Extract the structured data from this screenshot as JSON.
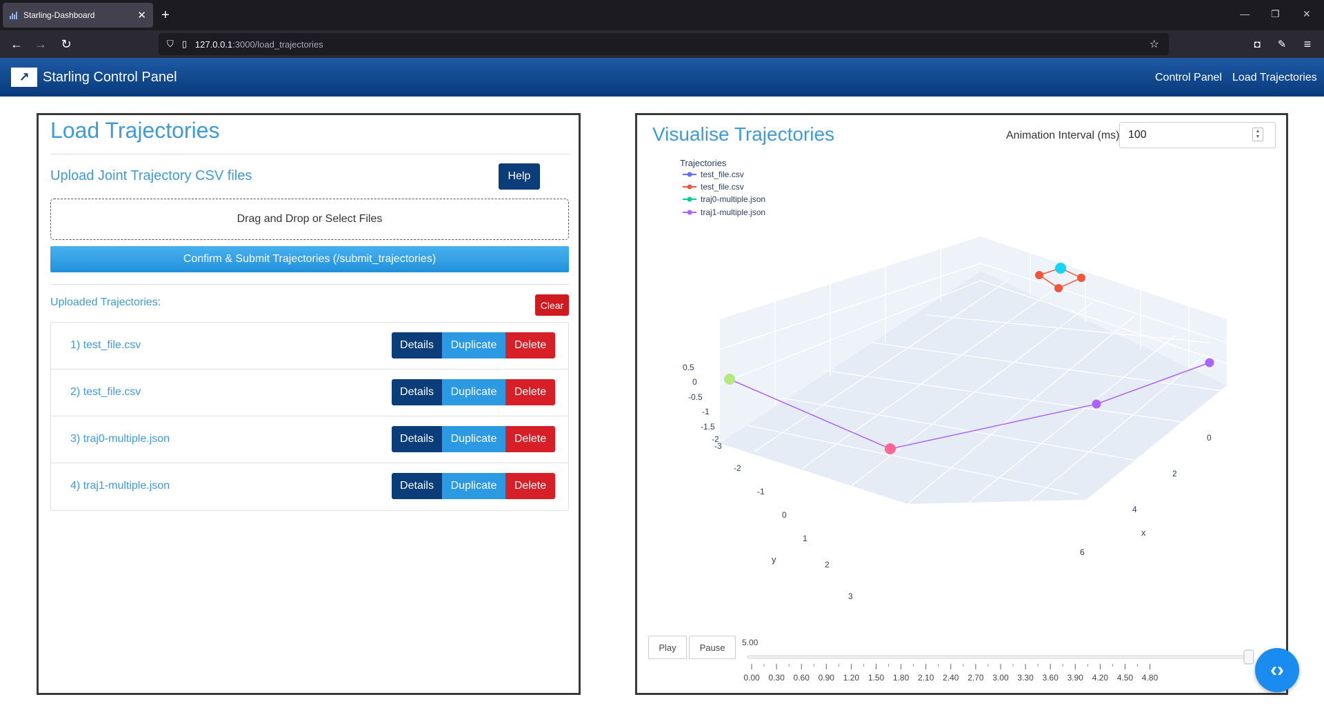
{
  "browser": {
    "tab_title": "Starling-Dashboard",
    "url_host": "127.0.0.1",
    "url_path": ":3000/load_trajectories"
  },
  "app": {
    "title": "Starling Control Panel",
    "nav": [
      "Control Panel",
      "Load Trajectories"
    ]
  },
  "load": {
    "heading": "Load Trajectories",
    "upload_heading": "Upload Joint Trajectory CSV files",
    "help_label": "Help",
    "dropzone_text": "Drag and Drop or Select Files",
    "confirm_label": "Confirm & Submit Trajectories (/submit_trajectories)",
    "uploaded_label": "Uploaded Trajectories:",
    "clear_label": "Clear",
    "details_label": "Details",
    "duplicate_label": "Duplicate",
    "delete_label": "Delete",
    "trajectories": [
      "1) test_file.csv",
      "2) test_file.csv",
      "3) traj0-multiple.json",
      "4) traj1-multiple.json"
    ]
  },
  "vis": {
    "heading": "Visualise Trajectories",
    "interval_label": "Animation Interval (ms)",
    "interval_value": "100",
    "play_label": "Play",
    "pause_label": "Pause",
    "slider_value": "5.00",
    "slider_fraction": 1.0,
    "slider_ticks": [
      "0.00",
      "0.30",
      "0.60",
      "0.90",
      "1.20",
      "1.50",
      "1.80",
      "2.10",
      "2.40",
      "2.70",
      "3.00",
      "3.30",
      "3.60",
      "3.90",
      "4.20",
      "4.50",
      "4.80"
    ]
  },
  "colors": {
    "accent": "#3e9ad8",
    "navy": "#0a3d7a",
    "danger": "#d71f27",
    "series1": "#636efa",
    "series2": "#ef553b",
    "series3": "#00cc96",
    "series4": "#ab63fa"
  },
  "chart_data": {
    "type": "scatter",
    "legend_title": "Trajectories",
    "legend_placement": "top-left",
    "series": [
      {
        "name": "test_file.csv",
        "color": "#636efa"
      },
      {
        "name": "test_file.csv",
        "color": "#ef553b"
      },
      {
        "name": "traj0-multiple.json",
        "color": "#00cc96"
      },
      {
        "name": "traj1-multiple.json",
        "color": "#ab63fa"
      }
    ],
    "xlabel": "x",
    "ylabel": "y",
    "x_ticks": [
      "0",
      "2",
      "4",
      "6"
    ],
    "y_ticks": [
      "-2",
      "-1",
      "0",
      "1",
      "2",
      "3"
    ],
    "z_ticks": [
      "0.5",
      "0",
      "-0.5",
      "-1",
      "-1.5",
      "-2",
      "-3"
    ],
    "grid": true
  }
}
